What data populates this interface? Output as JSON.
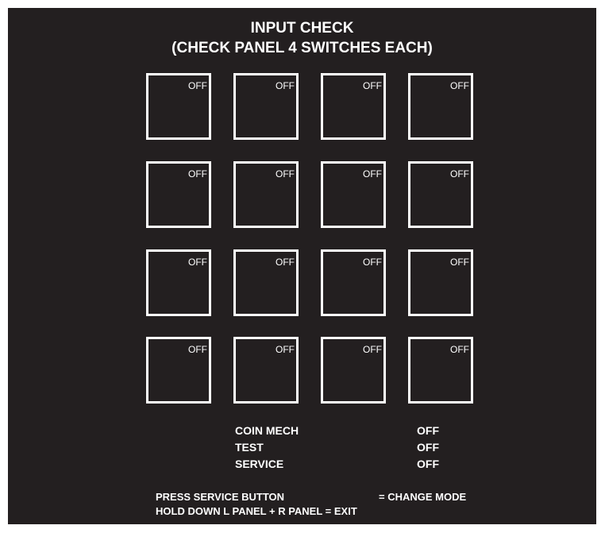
{
  "title": {
    "line1": "INPUT CHECK",
    "line2": "(CHECK PANEL 4 SWITCHES EACH)"
  },
  "panels": [
    {
      "state": "OFF"
    },
    {
      "state": "OFF"
    },
    {
      "state": "OFF"
    },
    {
      "state": "OFF"
    },
    {
      "state": "OFF"
    },
    {
      "state": "OFF"
    },
    {
      "state": "OFF"
    },
    {
      "state": "OFF"
    },
    {
      "state": "OFF"
    },
    {
      "state": "OFF"
    },
    {
      "state": "OFF"
    },
    {
      "state": "OFF"
    },
    {
      "state": "OFF"
    },
    {
      "state": "OFF"
    },
    {
      "state": "OFF"
    },
    {
      "state": "OFF"
    }
  ],
  "status": [
    {
      "label": "COIN MECH",
      "value": "OFF"
    },
    {
      "label": "TEST",
      "value": "OFF"
    },
    {
      "label": "SERVICE",
      "value": "OFF"
    }
  ],
  "footer": {
    "line1_action": "PRESS SERVICE BUTTON",
    "line1_result": "= CHANGE MODE",
    "line2": "HOLD DOWN L PANEL + R PANEL = EXIT"
  },
  "colors": {
    "background": "#231f20",
    "foreground": "#ffffff"
  }
}
